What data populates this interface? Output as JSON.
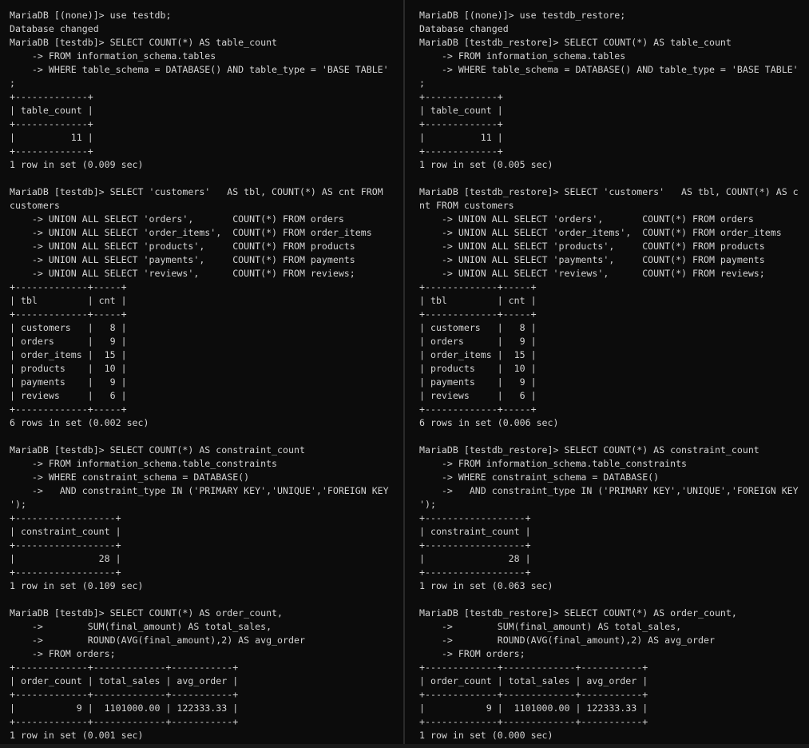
{
  "panes": [
    {
      "name": "left",
      "lines": [
        "MariaDB [(none)]> use testdb;",
        "Database changed",
        "MariaDB [testdb]> SELECT COUNT(*) AS table_count",
        "    -> FROM information_schema.tables",
        "    -> WHERE table_schema = DATABASE() AND table_type = 'BASE TABLE'",
        ";",
        "+-------------+",
        "| table_count |",
        "+-------------+",
        "|          11 |",
        "+-------------+",
        "1 row in set (0.009 sec)",
        "",
        "MariaDB [testdb]> SELECT 'customers'   AS tbl, COUNT(*) AS cnt FROM",
        "customers",
        "    -> UNION ALL SELECT 'orders',       COUNT(*) FROM orders",
        "    -> UNION ALL SELECT 'order_items',  COUNT(*) FROM order_items",
        "    -> UNION ALL SELECT 'products',     COUNT(*) FROM products",
        "    -> UNION ALL SELECT 'payments',     COUNT(*) FROM payments",
        "    -> UNION ALL SELECT 'reviews',      COUNT(*) FROM reviews;",
        "+-------------+-----+",
        "| tbl         | cnt |",
        "+-------------+-----+",
        "| customers   |   8 |",
        "| orders      |   9 |",
        "| order_items |  15 |",
        "| products    |  10 |",
        "| payments    |   9 |",
        "| reviews     |   6 |",
        "+-------------+-----+",
        "6 rows in set (0.002 sec)",
        "",
        "MariaDB [testdb]> SELECT COUNT(*) AS constraint_count",
        "    -> FROM information_schema.table_constraints",
        "    -> WHERE constraint_schema = DATABASE()",
        "    ->   AND constraint_type IN ('PRIMARY KEY','UNIQUE','FOREIGN KEY",
        "');",
        "+------------------+",
        "| constraint_count |",
        "+------------------+",
        "|               28 |",
        "+------------------+",
        "1 row in set (0.109 sec)",
        "",
        "MariaDB [testdb]> SELECT COUNT(*) AS order_count,",
        "    ->        SUM(final_amount) AS total_sales,",
        "    ->        ROUND(AVG(final_amount),2) AS avg_order",
        "    -> FROM orders;",
        "+-------------+-------------+-----------+",
        "| order_count | total_sales | avg_order |",
        "+-------------+-------------+-----------+",
        "|           9 |  1101000.00 | 122333.33 |",
        "+-------------+-------------+-----------+",
        "1 row in set (0.001 sec)"
      ]
    },
    {
      "name": "right",
      "lines": [
        "MariaDB [(none)]> use testdb_restore;",
        "Database changed",
        "MariaDB [testdb_restore]> SELECT COUNT(*) AS table_count",
        "    -> FROM information_schema.tables",
        "    -> WHERE table_schema = DATABASE() AND table_type = 'BASE TABLE'",
        ";",
        "+-------------+",
        "| table_count |",
        "+-------------+",
        "|          11 |",
        "+-------------+",
        "1 row in set (0.005 sec)",
        "",
        "MariaDB [testdb_restore]> SELECT 'customers'   AS tbl, COUNT(*) AS c",
        "nt FROM customers",
        "    -> UNION ALL SELECT 'orders',       COUNT(*) FROM orders",
        "    -> UNION ALL SELECT 'order_items',  COUNT(*) FROM order_items",
        "    -> UNION ALL SELECT 'products',     COUNT(*) FROM products",
        "    -> UNION ALL SELECT 'payments',     COUNT(*) FROM payments",
        "    -> UNION ALL SELECT 'reviews',      COUNT(*) FROM reviews;",
        "+-------------+-----+",
        "| tbl         | cnt |",
        "+-------------+-----+",
        "| customers   |   8 |",
        "| orders      |   9 |",
        "| order_items |  15 |",
        "| products    |  10 |",
        "| payments    |   9 |",
        "| reviews     |   6 |",
        "+-------------+-----+",
        "6 rows in set (0.006 sec)",
        "",
        "MariaDB [testdb_restore]> SELECT COUNT(*) AS constraint_count",
        "    -> FROM information_schema.table_constraints",
        "    -> WHERE constraint_schema = DATABASE()",
        "    ->   AND constraint_type IN ('PRIMARY KEY','UNIQUE','FOREIGN KEY",
        "');",
        "+------------------+",
        "| constraint_count |",
        "+------------------+",
        "|               28 |",
        "+------------------+",
        "1 row in set (0.063 sec)",
        "",
        "MariaDB [testdb_restore]> SELECT COUNT(*) AS order_count,",
        "    ->        SUM(final_amount) AS total_sales,",
        "    ->        ROUND(AVG(final_amount),2) AS avg_order",
        "    -> FROM orders;",
        "+-------------+-------------+-----------+",
        "| order_count | total_sales | avg_order |",
        "+-------------+-------------+-----------+",
        "|           9 |  1101000.00 | 122333.33 |",
        "+-------------+-------------+-----------+",
        "1 row in set (0.000 sec)"
      ]
    }
  ]
}
